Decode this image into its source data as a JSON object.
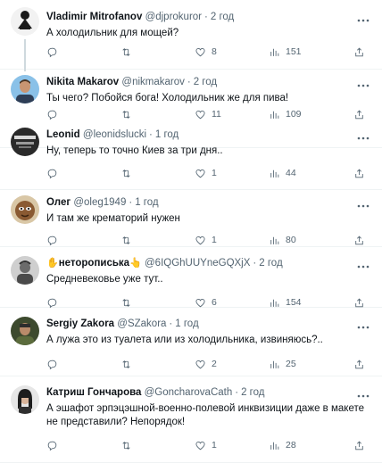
{
  "tweets": [
    {
      "name": "Vladimir Mitrofanov",
      "handle": "@djprokuror",
      "time": "2 год",
      "text": "А холодильник для мощей?",
      "replies": "",
      "retweets": "",
      "likes": "8",
      "views": "151"
    },
    {
      "name": "Nikita Makarov",
      "handle": "@nikmakarov",
      "time": "2 год",
      "text": "Ты чего? Побойся бога! Холодильник же для пива!",
      "replies": "",
      "retweets": "",
      "likes": "11",
      "views": "109"
    },
    {
      "name": "Leonid",
      "handle": "@leonidslucki",
      "time": "1 год",
      "text": "Ну, теперь то точно Киев за три дня..",
      "replies": "",
      "retweets": "",
      "likes": "1",
      "views": "44"
    },
    {
      "name": "Олег",
      "handle": "@oleg1949",
      "time": "1 год",
      "text": "И там же крематорий нужен",
      "replies": "",
      "retweets": "",
      "likes": "1",
      "views": "80"
    },
    {
      "name_prefix": "✋",
      "name": "неторописька",
      "name_suffix": "👆",
      "handle": "@6IQGhUUYneGQXjX",
      "time": "2 год",
      "text": "Средневековье уже тут..",
      "replies": "",
      "retweets": "",
      "likes": "6",
      "views": "154"
    },
    {
      "name": "Sergiy Zakora",
      "handle": "@SZakora",
      "time": "1 год",
      "text": "А лужа это из туалета или из холодильника, извиняюсь?..",
      "replies": "",
      "retweets": "",
      "likes": "2",
      "views": "25"
    },
    {
      "name": "Катриш Гончарова",
      "handle": "@GoncharovaCath",
      "time": "2 год",
      "text": "А эшафот эрпэцэшной-военно-полевой инквизиции даже в макете не представили? Непорядок!",
      "replies": "",
      "retweets": "",
      "likes": "1",
      "views": "28"
    }
  ],
  "icons": {
    "more": "more-dots-icon",
    "reply": "reply-icon",
    "retweet": "retweet-icon",
    "like": "heart-icon",
    "views": "views-chart-icon",
    "share": "share-icon"
  },
  "colors": {
    "text": "#0f1419",
    "secondary": "#536471",
    "border": "#eff3f4",
    "thread_line": "#cfd9de"
  }
}
